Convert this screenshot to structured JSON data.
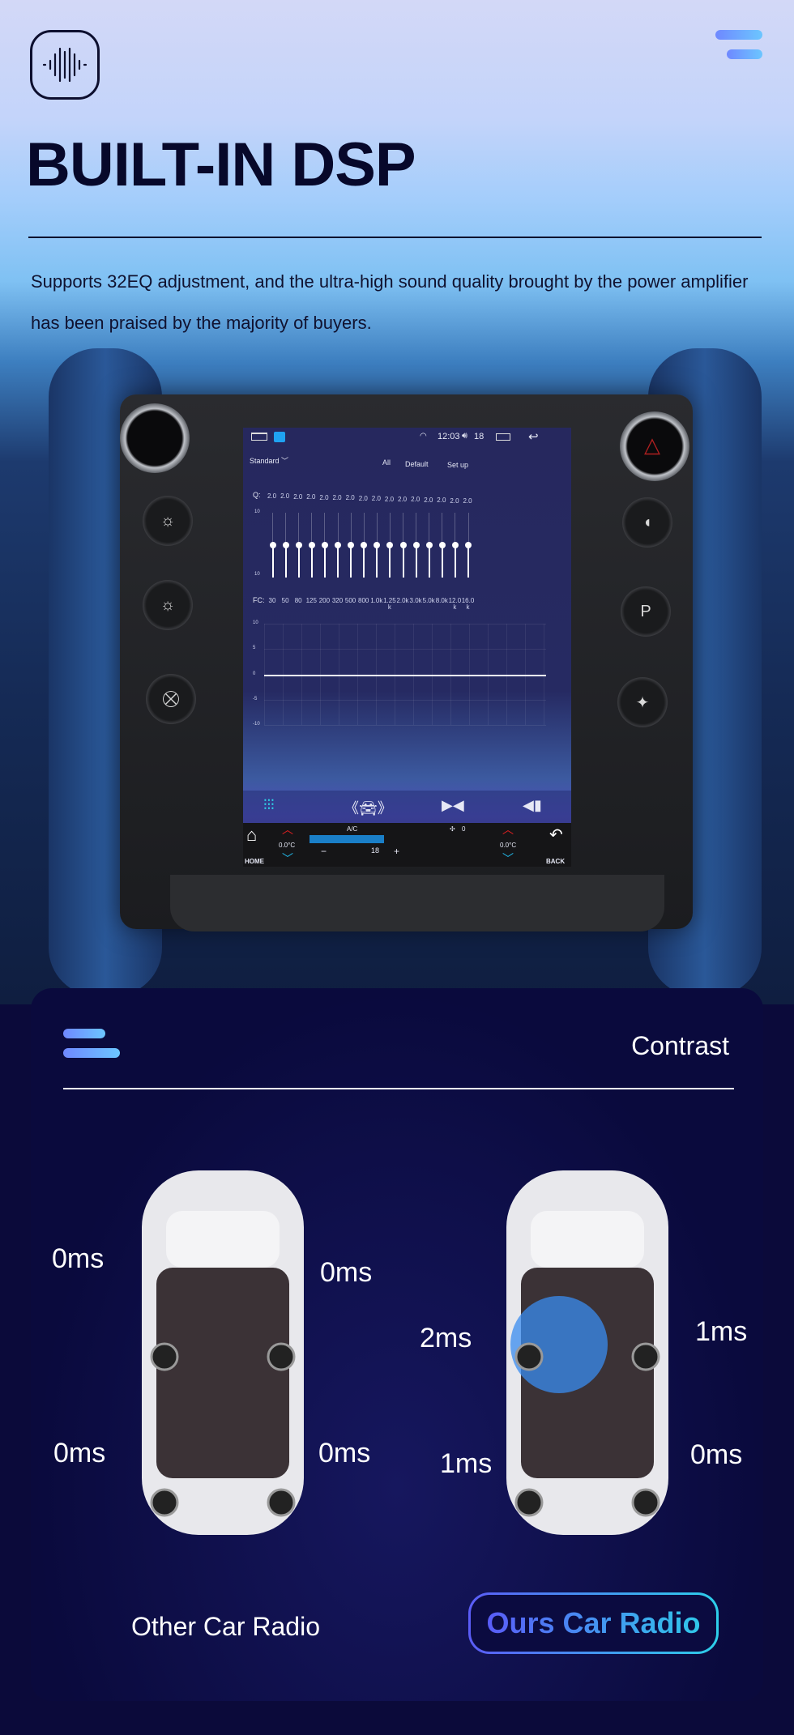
{
  "header": {
    "logo_icon": "sound-wave-icon",
    "menu_icon": "menu-icon",
    "title": "BUILT-IN DSP",
    "description": "Supports 32EQ adjustment, and the ultra-high sound quality brought by the power amplifier has been praised by the majority of buyers."
  },
  "head_unit": {
    "status_bar": {
      "time": "12:03",
      "volume": "18",
      "icons": [
        "home-outline-icon",
        "app-icon",
        "signal-icon",
        "volume-icon",
        "recent-apps-icon",
        "back-icon"
      ]
    },
    "preset": "Standard",
    "actions": [
      "All",
      "Default",
      "Set up"
    ],
    "q_label": "Q:",
    "q_values": [
      "2.0",
      "2.0",
      "2.0",
      "2.0",
      "2.0",
      "2.0",
      "2.0",
      "2.0",
      "2.0",
      "2.0",
      "2.0",
      "2.0",
      "2.0",
      "2.0",
      "2.0",
      "2.0"
    ],
    "slider_scale": {
      "top": "10",
      "bottom": "10"
    },
    "eq_gains": [
      0,
      0,
      0,
      0,
      0,
      0,
      0,
      0,
      0,
      0,
      0,
      0,
      0,
      0,
      0,
      0
    ],
    "fc_label": "FC:",
    "fc_values": [
      "30",
      "50",
      "80",
      "125",
      "200",
      "320",
      "500",
      "800",
      "1.0k",
      "1.25 k",
      "2.0k",
      "3.0k",
      "5.0k",
      "8.0k",
      "12.0 k",
      "16.0 k"
    ],
    "response_axis": [
      "10",
      "5",
      "0",
      "-5",
      "-10"
    ],
    "bottom_tabs": [
      "equalizer-icon",
      "car-surround-icon",
      "balance-icon",
      "bass-sound-icon"
    ],
    "climate": {
      "home": "HOME",
      "back": "BACK",
      "ac": "A/C",
      "fan": "0",
      "left_temp": "0.0°C",
      "right_temp": "0.0°C",
      "set_temp": "18",
      "minus": "−",
      "plus": "+"
    }
  },
  "contrast": {
    "title": "Contrast",
    "other": {
      "label": "Other Car Radio",
      "delays": [
        "0ms",
        "0ms",
        "0ms",
        "0ms"
      ]
    },
    "ours": {
      "label": "Ours Car Radio",
      "delays": [
        "2ms",
        "1ms",
        "1ms",
        "0ms"
      ]
    }
  },
  "colors": {
    "accent_start": "#5a5cf8",
    "accent_end": "#30c8ea",
    "card_bg": "#0a0a3d",
    "title": "#07082a"
  }
}
